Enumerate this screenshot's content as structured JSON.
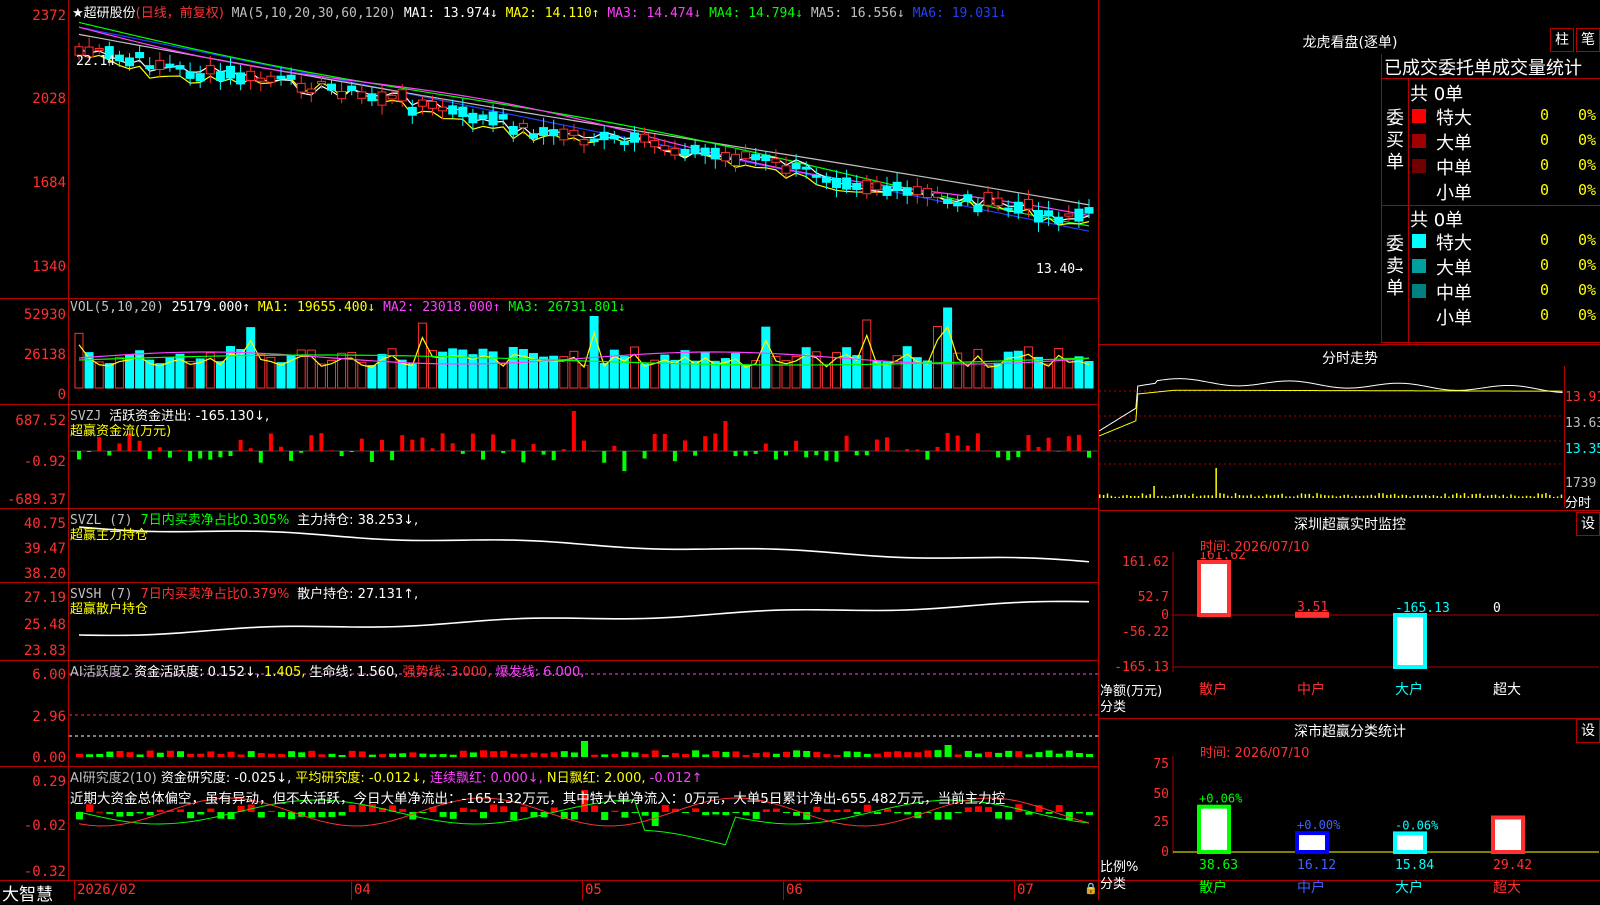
{
  "main": {
    "title_prefix": "★超研股份",
    "title_mode": "(日线，前复权)",
    "ma_label": "MA(5,10,20,30,60,120)",
    "ma1": "MA1: 13.974↓",
    "ma2": "MA2: 14.110↑",
    "ma3": "MA3: 14.474↓",
    "ma4": "MA4: 14.794↓",
    "ma5": "MA5: 16.556↓",
    "ma6": "MA6: 19.031↓",
    "y_ticks": [
      "2372",
      "2028",
      "1684",
      "1340"
    ],
    "high_label": "22.14",
    "low_label": "13.40→"
  },
  "vol": {
    "label": "VOL(5,10,20)",
    "value": "25179.000↑",
    "ma1": "MA1: 19655.400↓",
    "ma2": "MA2: 23018.000↑",
    "ma3": "MA3: 26731.801↓",
    "y_ticks": [
      "52930",
      "26138",
      "0"
    ]
  },
  "svzj": {
    "label": "SVZJ",
    "title": "活跃资金进出: -165.130↓,",
    "subtitle": "超赢资金流(万元)",
    "y_ticks": [
      "687.52",
      "-0.92",
      "-689.37"
    ]
  },
  "svzl": {
    "label": "SVZL (7)",
    "ratio": "7日内买卖净占比0.305%",
    "hold": "主力持仓: 38.253↓,",
    "subtitle": "超赢主力持仓",
    "y_ticks": [
      "40.75",
      "39.47",
      "38.20"
    ]
  },
  "svsh": {
    "label": "SVSH (7)",
    "ratio": "7日内买卖净占比0.379%",
    "hold": "散户持仓: 27.131↑,",
    "subtitle": "超赢散户持仓",
    "y_ticks": [
      "27.19",
      "25.48",
      "23.83"
    ]
  },
  "ai_active": {
    "label": "AI活跃度2",
    "fund": "资金活跃度: 0.152↓,",
    "v2": "1.405,",
    "life": "生命线: 1.560,",
    "strong": "强势线: 3.000,",
    "burst": "爆发线: 6.000,",
    "y_ticks": [
      "6.00",
      "2.96",
      "0.00"
    ]
  },
  "ai_research": {
    "label": "AI研究度2(10)",
    "fund": "资金研究度: -0.025↓,",
    "avg": "平均研究度: -0.012↓,",
    "red": "连续飘红: 0.000↓,",
    "nday": "N日飘红: 2.000,",
    "tail": "-0.012↑",
    "desc": "近期大资金总体偏空，虽有异动，但不太活跃，今日大单净流出：-165.132万元，其中特大单净流入：0万元，大单5日累计净出-655.482万元，当前主力控",
    "y_ticks": [
      "0.29",
      "-0.02",
      "-0.32"
    ]
  },
  "bottom": {
    "app": "大智慧",
    "dates": [
      "2026/02",
      "04",
      "05",
      "06",
      "07"
    ]
  },
  "right": {
    "dragon_title": "龙虎看盘(逐单)",
    "btn1": "柱",
    "btn2": "笔",
    "tabs_title": "已成交委托单成交量统计",
    "buy_side": "委买单",
    "sell_side": "委卖单",
    "buy_total": "共 0单",
    "sell_total": "共 0单",
    "buy_rows": [
      {
        "label": "特大",
        "count": "0",
        "pct": "0%",
        "color": "#ff0000"
      },
      {
        "label": "大单",
        "count": "0",
        "pct": "0%",
        "color": "#a00000"
      },
      {
        "label": "中单",
        "count": "0",
        "pct": "0%",
        "color": "#700000"
      },
      {
        "label": "小单",
        "count": "0",
        "pct": "0%",
        "color": ""
      }
    ],
    "sell_rows": [
      {
        "label": "特大",
        "count": "0",
        "pct": "0%",
        "color": "#00ffff"
      },
      {
        "label": "大单",
        "count": "0",
        "pct": "0%",
        "color": "#00a0a0"
      },
      {
        "label": "中单",
        "count": "0",
        "pct": "0%",
        "color": "#008080"
      },
      {
        "label": "小单",
        "count": "0",
        "pct": "0%",
        "color": ""
      }
    ],
    "intraday_title": "分时走势",
    "intraday_ticks": [
      "13.91",
      "13.63",
      "13.35",
      "1739",
      "分时"
    ],
    "monitor_title": "深圳超赢实时监控",
    "monitor_btn": "设",
    "monitor_time": "时间: 2026/07/10",
    "monitor_ticks": [
      "161.62",
      "52.7",
      "0",
      "-56.22",
      "-165.13"
    ],
    "monitor_axis_label": "净额(万元)",
    "monitor_axis_sub": "分类",
    "monitor_values": [
      {
        "cat": "散户",
        "value": "161.62"
      },
      {
        "cat": "中户",
        "value": "3.51"
      },
      {
        "cat": "大户",
        "value": "-165.13"
      },
      {
        "cat": "超大",
        "value": "0"
      }
    ],
    "stats_title": "深市超赢分类统计",
    "stats_btn": "设",
    "stats_time": "时间: 2026/07/10",
    "stats_ticks": [
      "75",
      "50",
      "25",
      "0"
    ],
    "stats_axis_label": "比例%",
    "stats_axis_sub": "分类",
    "stats_values": [
      {
        "cat": "散户",
        "value": "38.63",
        "change": "+0.06%"
      },
      {
        "cat": "中户",
        "value": "16.12",
        "change": "+0.00%"
      },
      {
        "cat": "大户",
        "value": "15.84",
        "change": "-0.06%"
      },
      {
        "cat": "超大",
        "value": "29.42",
        "change": ""
      }
    ]
  }
}
